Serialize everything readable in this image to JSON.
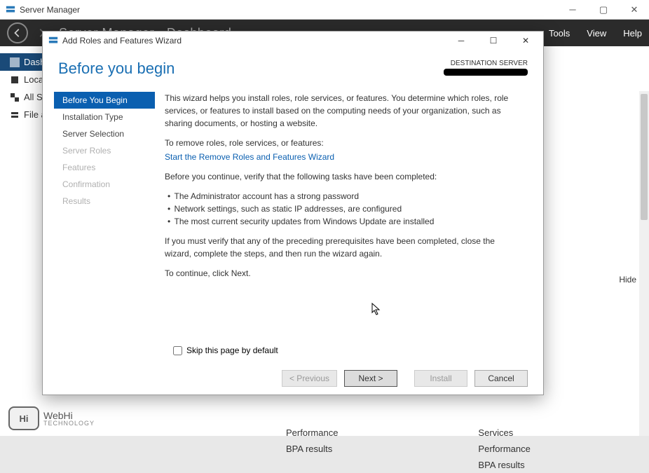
{
  "mainWindow": {
    "title": "Server Manager",
    "header": {
      "breadcrumb": "Server Manager • Dashboard"
    },
    "menu": {
      "tools": "Tools",
      "view": "View",
      "help": "Help"
    },
    "sidebar": {
      "items": [
        {
          "label": "Dashboard"
        },
        {
          "label": "Local Server"
        },
        {
          "label": "All Servers"
        },
        {
          "label": "File and Storage Services"
        }
      ]
    },
    "hide": "Hide",
    "bottomCards": {
      "left": [
        "Performance",
        "BPA results"
      ],
      "right": [
        "Services",
        "Performance",
        "BPA results"
      ]
    }
  },
  "dialog": {
    "title": "Add Roles and Features Wizard",
    "heading": "Before you begin",
    "destinationLabel": "DESTINATION SERVER",
    "steps": [
      {
        "label": "Before You Begin",
        "state": "active"
      },
      {
        "label": "Installation Type",
        "state": "enabled"
      },
      {
        "label": "Server Selection",
        "state": "enabled"
      },
      {
        "label": "Server Roles",
        "state": "disabled"
      },
      {
        "label": "Features",
        "state": "disabled"
      },
      {
        "label": "Confirmation",
        "state": "disabled"
      },
      {
        "label": "Results",
        "state": "disabled"
      }
    ],
    "content": {
      "intro": "This wizard helps you install roles, role services, or features. You determine which roles, role services, or features to install based on the computing needs of your organization, such as sharing documents, or hosting a website.",
      "removeLabel": "To remove roles, role services, or features:",
      "removeLink": "Start the Remove Roles and Features Wizard",
      "verifyLabel": "Before you continue, verify that the following tasks have been completed:",
      "bullets": [
        "The Administrator account has a strong password",
        "Network settings, such as static IP addresses, are configured",
        "The most current security updates from Windows Update are installed"
      ],
      "prereq": "If you must verify that any of the preceding prerequisites have been completed, close the wizard, complete the steps, and then run the wizard again.",
      "continue": "To continue, click Next."
    },
    "skip": "Skip this page by default",
    "buttons": {
      "previous": "< Previous",
      "next": "Next >",
      "install": "Install",
      "cancel": "Cancel"
    }
  },
  "watermark": {
    "bubble": "Hi",
    "line1": "WebHi",
    "line2": "TECHNOLOGY"
  }
}
